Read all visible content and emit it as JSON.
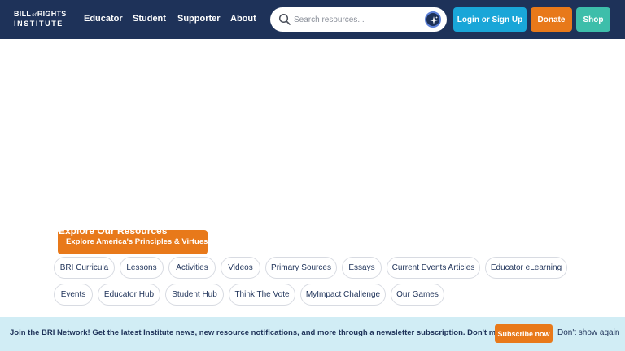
{
  "header": {
    "logo_line1_a": "BILL",
    "logo_line1_of": "of",
    "logo_line1_b": "RIGHTS",
    "logo_line2": "INSTITUTE",
    "nav": [
      "Educator",
      "Student",
      "Supporter",
      "About"
    ],
    "search_placeholder": "Search resources...",
    "login_label": "Login or Sign Up",
    "donate_label": "Donate",
    "shop_label": "Shop"
  },
  "hero": {
    "title": "Explore Our Resources",
    "button_label": "Explore America's Principles & Virtues"
  },
  "chips_row1": [
    "BRI Curricula",
    "Lessons",
    "Activities",
    "Videos",
    "Primary Sources",
    "Essays",
    "Current Events Articles",
    "Educator eLearning"
  ],
  "chips_row2": [
    "Events",
    "Educator Hub",
    "Student Hub",
    "Think The Vote",
    "MyImpact Challenge",
    "Our Games"
  ],
  "banner": {
    "message": "Join the BRI Network! Get the latest Institute news, new resource notifications, and more through a newsletter subscription. Don't miss out!",
    "subscribe_label": "Subscribe now",
    "dismiss_label": "Don't show again"
  },
  "colors": {
    "navy": "#1e3259",
    "orange": "#e8791a",
    "blue": "#19a6d8",
    "teal": "#3dbeaa",
    "banner_bg": "#d1edf5"
  },
  "icons": {
    "search": "search-icon",
    "ai": "sparkle-icon"
  }
}
